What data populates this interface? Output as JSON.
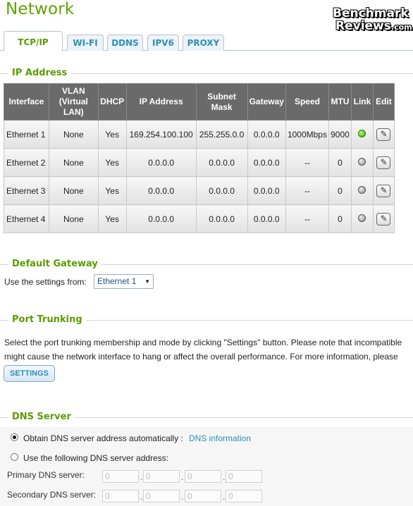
{
  "page": {
    "title": "Network"
  },
  "watermark": {
    "line1": "Benchmark",
    "line2": "Reviews",
    "suffix": ".com"
  },
  "tabs": [
    {
      "label": "TCP/IP",
      "active": true
    },
    {
      "label": "WI-FI"
    },
    {
      "label": "DDNS"
    },
    {
      "label": "IPV6"
    },
    {
      "label": "PROXY"
    }
  ],
  "sections": {
    "ip": "IP Address",
    "gateway": "Default Gateway",
    "trunking": "Port Trunking",
    "dns": "DNS Server"
  },
  "table": {
    "headers": [
      "Interface",
      "VLAN (Virtual LAN)",
      "DHCP",
      "IP Address",
      "Subnet Mask",
      "Gateway",
      "Speed",
      "MTU",
      "Link",
      "Edit"
    ],
    "rows": [
      {
        "interface": "Ethernet 1",
        "vlan": "None",
        "dhcp": "Yes",
        "ip": "169.254.100.100",
        "mask": "255.255.0.0",
        "gateway": "0.0.0.0",
        "speed": "1000Mbps",
        "mtu": "9000",
        "link": "up"
      },
      {
        "interface": "Ethernet 2",
        "vlan": "None",
        "dhcp": "Yes",
        "ip": "0.0.0.0",
        "mask": "0.0.0.0",
        "gateway": "0.0.0.0",
        "speed": "--",
        "mtu": "0",
        "link": "down"
      },
      {
        "interface": "Ethernet 3",
        "vlan": "None",
        "dhcp": "Yes",
        "ip": "0.0.0.0",
        "mask": "0.0.0.0",
        "gateway": "0.0.0.0",
        "speed": "--",
        "mtu": "0",
        "link": "down"
      },
      {
        "interface": "Ethernet 4",
        "vlan": "None",
        "dhcp": "Yes",
        "ip": "0.0.0.0",
        "mask": "0.0.0.0",
        "gateway": "0.0.0.0",
        "speed": "--",
        "mtu": "0",
        "link": "down"
      }
    ]
  },
  "gateway": {
    "label": "Use the settings from:",
    "selected": "Ethernet 1"
  },
  "trunking": {
    "line1": "Select the port trunking membership and mode by clicking \"Settings\" button. Please note that incompatible",
    "line2": "might cause the network interface to hang or affect the overall performance. For more information, please",
    "button": "SETTINGS"
  },
  "dns": {
    "auto_label": "Obtain DNS server address automatically :",
    "info_link": "DNS information",
    "manual_label": "Use the following DNS server address:",
    "primary_label": "Primary DNS server:",
    "secondary_label": "Secondary DNS server:",
    "primary": [
      "0",
      "0",
      "0",
      "0"
    ],
    "secondary": [
      "0",
      "0",
      "0",
      "0"
    ]
  },
  "colors": {
    "accent_green": "#5a9c00",
    "link_blue": "#2a8fbd",
    "header_gray": "#6a6a6a",
    "link_up": "#22b000"
  }
}
